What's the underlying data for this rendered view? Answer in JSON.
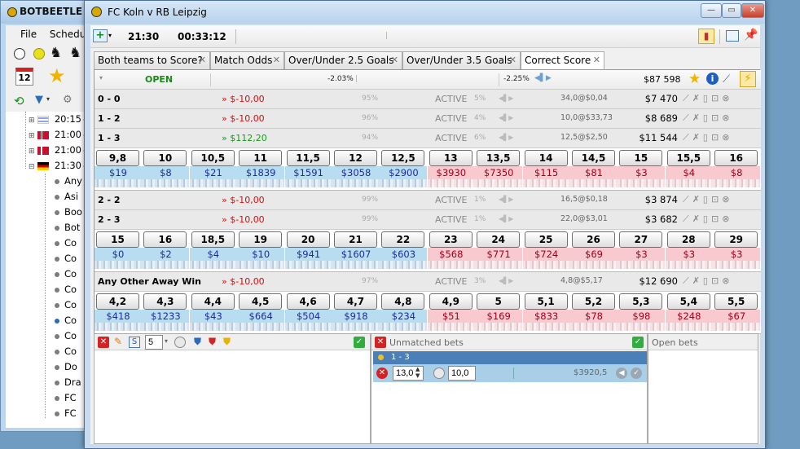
{
  "back_window": {
    "title": "BOTBEETLE - ",
    "menu": [
      "File",
      "Schedu"
    ],
    "calendar_day": "12",
    "tree": [
      {
        "time": "20:15",
        "label": "- "
      },
      {
        "time": "21:00",
        "label": "- "
      },
      {
        "time": "21:00",
        "label": "- "
      },
      {
        "time": "21:30",
        "label": "- "
      }
    ],
    "markets": [
      "Any",
      "Asi",
      "Boo",
      "Bot",
      "Co",
      "Co",
      "Co",
      "Co",
      "Co",
      "Co",
      "Co",
      "Co",
      "Do",
      "Dra",
      "FC",
      "FC"
    ]
  },
  "window": {
    "title": "FC Koln v RB Leipzig",
    "controls": {
      "minimize": "—",
      "maximize": "▭",
      "close": "✕"
    }
  },
  "toolbar": {
    "time": "21:30",
    "countdown": "00:33:12"
  },
  "tabs": [
    {
      "label": "Both teams to Score?"
    },
    {
      "label": "Match Odds"
    },
    {
      "label": "Over/Under 2.5 Goals"
    },
    {
      "label": "Over/Under 3.5 Goals"
    },
    {
      "label": "Correct Score"
    }
  ],
  "header": {
    "status": "OPEN",
    "back_pct": "-2.03%",
    "lay_pct": "-2.25%",
    "total_matched": "$87 598"
  },
  "runners": [
    {
      "name": "0 - 0",
      "pl": "» $-10,00",
      "pct": "95%",
      "status": "ACTIVE",
      "pct2": "5%",
      "ex": "34,0@$0,04",
      "vol": "$7 470"
    },
    {
      "name": "1 - 2",
      "pl": "» $-10,00",
      "pct": "96%",
      "status": "ACTIVE",
      "pct2": "4%",
      "ex": "10,0@$33,73",
      "vol": "$8 689"
    },
    {
      "name": "1 - 3",
      "pl": "» $112,20",
      "pct": "94%",
      "status": "ACTIVE",
      "pct2": "6%",
      "ex": "12,5@$2,50",
      "vol": "$11 544"
    },
    {
      "name": "2 - 2",
      "pl": "» $-10,00",
      "pct": "99%",
      "status": "ACTIVE",
      "pct2": "1%",
      "ex": "16,5@$0,18",
      "vol": "$3 874"
    },
    {
      "name": "2 - 3",
      "pl": "» $-10,00",
      "pct": "99%",
      "status": "ACTIVE",
      "pct2": "1%",
      "ex": "22,0@$3,01",
      "vol": "$3 682"
    },
    {
      "name": "Any Other Away Win",
      "pl": "» $-10,00",
      "pct": "97%",
      "status": "ACTIVE",
      "pct2": "3%",
      "ex": "4,8@$5,17",
      "vol": "$12 690"
    }
  ],
  "ladders": [
    {
      "prices": [
        "9,8",
        "10",
        "10,5",
        "11",
        "11,5",
        "12",
        "12,5",
        "13",
        "13,5",
        "14",
        "14,5",
        "15",
        "15,5",
        "16"
      ],
      "amounts": [
        "$19",
        "$8",
        "$21",
        "$1839",
        "$1591",
        "$3058",
        "$2900",
        "$3930",
        "$7350",
        "$115",
        "$81",
        "$3",
        "$4",
        "$8"
      ]
    },
    {
      "prices": [
        "15",
        "16",
        "18,5",
        "19",
        "20",
        "21",
        "22",
        "23",
        "24",
        "25",
        "26",
        "27",
        "28",
        "29"
      ],
      "amounts": [
        "$0",
        "$2",
        "$4",
        "$10",
        "$941",
        "$1607",
        "$603",
        "$568",
        "$771",
        "$724",
        "$69",
        "$3",
        "$3",
        "$3"
      ]
    },
    {
      "prices": [
        "4,2",
        "4,3",
        "4,4",
        "4,5",
        "4,6",
        "4,7",
        "4,8",
        "4,9",
        "5",
        "5,1",
        "5,2",
        "5,3",
        "5,4",
        "5,5"
      ],
      "amounts": [
        "$418",
        "$1233",
        "$43",
        "$664",
        "$504",
        "$918",
        "$234",
        "$51",
        "$169",
        "$833",
        "$78",
        "$98",
        "$248",
        "$67"
      ]
    }
  ],
  "bottom": {
    "stake_input": "5",
    "unmatched_title": "Unmatched bets",
    "open_title": "Open bets",
    "bet_selection": "1 - 3",
    "bet_odds": "13,0",
    "bet_stake": "10,0",
    "bet_liability": "$3920,5"
  },
  "colors": {
    "back": "#b8dcf0",
    "lay": "#f8c9cf",
    "loss": "#d01010",
    "profit": "#1a9a1a",
    "open": "#1a8a1a"
  }
}
